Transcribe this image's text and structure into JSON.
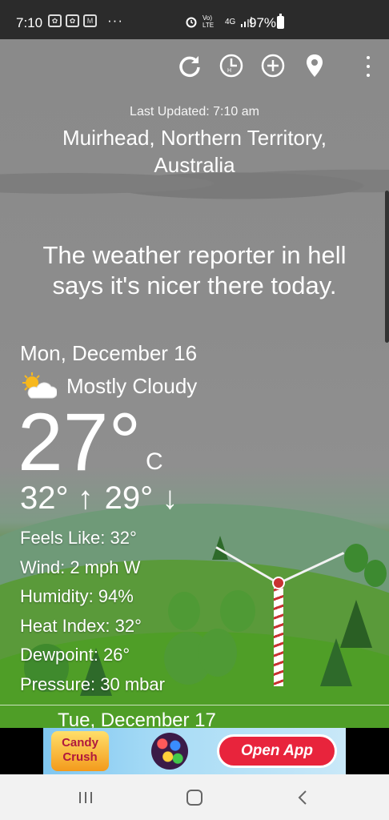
{
  "status_bar": {
    "time": "7:10",
    "more": "···",
    "network": "4G",
    "volte": "Vo) LTE",
    "battery": "97%"
  },
  "header": {
    "last_updated": "Last Updated: 7:10 am",
    "location": "Muirhead, Northern Territory, Australia"
  },
  "quip": "The weather reporter in hell says it's nicer there today.",
  "current": {
    "date": "Mon, December 16",
    "condition": "Mostly Cloudy",
    "condition_icon": "partly-cloudy-icon",
    "temperature": "27°",
    "unit": "C",
    "high": "32° ↑",
    "low": "29° ↓",
    "details": {
      "feels_like": "Feels Like: 32°",
      "wind": "Wind: 2 mph W",
      "humidity": "Humidity: 94%",
      "heat_index": "Heat Index: 32°",
      "dewpoint": "Dewpoint: 26°",
      "pressure": "Pressure: 30 mbar"
    }
  },
  "next_day": {
    "date": "Tue, December 17"
  },
  "ad": {
    "brand_line1": "Candy",
    "brand_line2": "Crush",
    "button": "Open App"
  },
  "actions": [
    "refresh-icon",
    "history-clock-icon",
    "add-location-icon",
    "location-pin-icon",
    "more-vert-icon"
  ]
}
